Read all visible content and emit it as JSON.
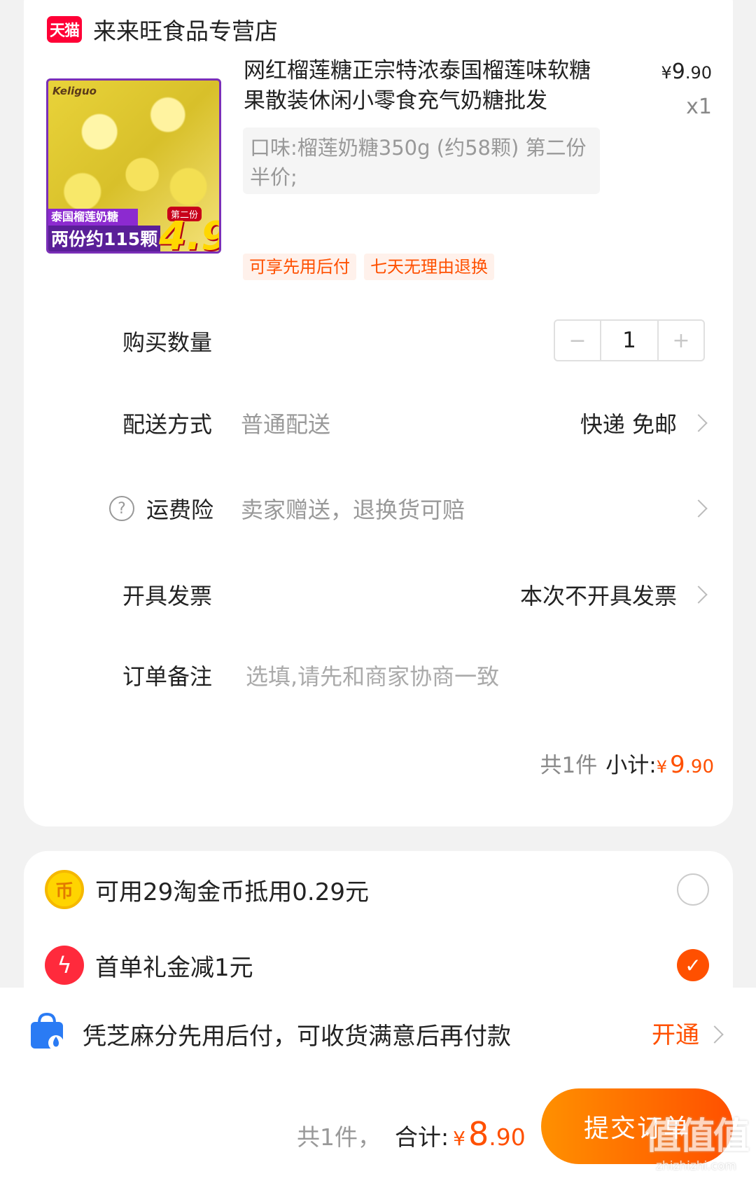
{
  "shop": {
    "badge": "天猫",
    "name": "来来旺食品专营店"
  },
  "product": {
    "image_text": {
      "brand": "Keliguo",
      "band1": "泰国榴莲奶糖",
      "band2": "两份约115颗",
      "second": "第二份",
      "price": "4.9"
    },
    "title": "网红榴莲糖正宗特浓泰国榴莲味软糖果散装休闲小零食充气奶糖批发",
    "price_yen": "¥",
    "price_int": "9",
    "price_dec": ".90",
    "quantity": "x1",
    "spec": "口味:榴莲奶糖350g (约58颗) 第二份半价;",
    "tags": [
      "可享先用后付",
      "七天无理由退换"
    ]
  },
  "rows": {
    "quantity_label": "购买数量",
    "quantity_minus": "−",
    "quantity_value": "1",
    "quantity_plus": "+",
    "delivery_label": "配送方式",
    "delivery_sub": "普通配送",
    "delivery_value": "快递 免邮",
    "insurance_label": "运费险",
    "insurance_sub": "卖家赠送，退换货可赔",
    "invoice_label": "开具发票",
    "invoice_value": "本次不开具发票",
    "remark_label": "订单备注",
    "remark_placeholder": "选填,请先和商家协商一致"
  },
  "subtotal": {
    "count": "共1件",
    "label": "小计:",
    "yen": "¥",
    "int": "9",
    "dec": ".90"
  },
  "benefits": [
    {
      "text": "可用29淘金币抵用0.29元",
      "icon": "coin-icon",
      "checked": false
    },
    {
      "text": "首单礼金减1元",
      "icon": "bolt-icon",
      "checked": true
    }
  ],
  "credit": {
    "text": "凭芝麻分先用后付，可收货满意后再付款",
    "action": "开通"
  },
  "footer": {
    "count": "共1件，",
    "label": "合计:",
    "yen": "¥",
    "int": "8",
    "dec": ".90",
    "submit": "提交订单"
  },
  "watermark": {
    "big": "值值值",
    "small": "zhizhizhi.com"
  },
  "colors": {
    "accent": "#ff5000",
    "tmall": "#ff0036",
    "page_bg": "#f2f2f2"
  }
}
